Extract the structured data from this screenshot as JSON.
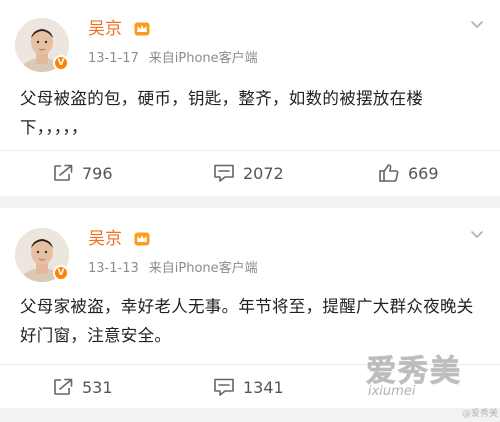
{
  "posts": [
    {
      "author": "吴京",
      "date": "13-1-17",
      "source": "来自iPhone客户端",
      "content": "父母被盗的包，硬币，钥匙，整齐，如数的被摆放在楼下，，，，，",
      "repost_count": "796",
      "comment_count": "2072",
      "like_count": "669"
    },
    {
      "author": "吴京",
      "date": "13-1-13",
      "source": "来自iPhone客户端",
      "content": "父母家被盗，幸好老人无事。年节将至，提醒广大群众夜晚关好门窗，注意安全。",
      "repost_count": "531",
      "comment_count": "1341"
    }
  ],
  "watermark": {
    "text": "爱秀美",
    "domain": "ixiumei",
    "credit": "@爱秀美"
  },
  "icons": {
    "repost": "repost-icon",
    "comment": "comment-icon",
    "like": "thumbs-up-icon",
    "more": "chevron-down-icon",
    "verified": "verified-badge-icon",
    "vip": "vip-crown-icon"
  },
  "colors": {
    "accent": "#f36f21",
    "verified": "#ff8200",
    "text": "#222222",
    "meta": "#8c8c8c",
    "background": "#f2f2f2"
  }
}
